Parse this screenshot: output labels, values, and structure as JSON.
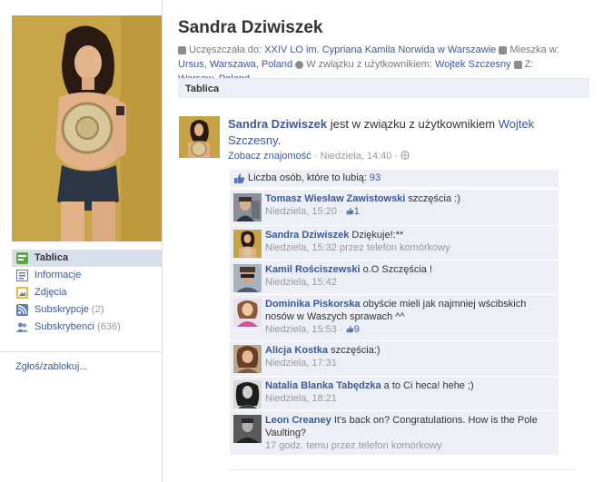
{
  "profile": {
    "name": "Sandra Dziwiszek",
    "info": {
      "school_label": "Uczęszczała do:",
      "school_value": "XXIV LO im. Cypriana Kamila Norwida w Warszawie",
      "lives_label": "Mieszka w:",
      "lives_value": "Ursus, Warszawa, Poland",
      "relationship_label": "W związku z użytkownikiem:",
      "relationship_value": "Wojtek Szczesny",
      "from_label": "Z:",
      "from_value": "Warsaw, Poland"
    }
  },
  "sidebar": {
    "items": [
      {
        "label": "Tablica",
        "count": "",
        "icon": "wall-icon",
        "active": true
      },
      {
        "label": "Informacje",
        "count": "",
        "icon": "info-icon",
        "active": false
      },
      {
        "label": "Zdjęcia",
        "count": "",
        "icon": "photos-icon",
        "active": false
      },
      {
        "label": "Subskrypcje",
        "count": "(2)",
        "icon": "subscriptions-icon",
        "active": false
      },
      {
        "label": "Subskrybenci",
        "count": "(636)",
        "icon": "subscribers-icon",
        "active": false
      }
    ],
    "report_label": "Zgłoś/zablokuj..."
  },
  "wall": {
    "tab_label": "Tablica"
  },
  "story": {
    "author": "Sandra Dziwiszek",
    "text_middle": "jest w związku z użytkownikiem",
    "target": "Wojtek Szczesny",
    "text_end": ".",
    "see_friendship": "Zobacz znajomość",
    "separator": "·",
    "time": "Niedziela, 14:40",
    "privacy_icon": "globe-icon",
    "likes_label": "Liczba osób, które to lubią:",
    "likes_count": "93"
  },
  "comments": [
    {
      "author": "Tomasz Wiesław Zawistowski",
      "text": "szczęścia :)",
      "time": "Niedziela, 15:20",
      "likes": "1",
      "via": ""
    },
    {
      "author": "Sandra Dziwiszek",
      "text": "Dziękuje!:**",
      "time": "Niedziela, 15:32",
      "likes": "",
      "via": "przez telefon komórkowy"
    },
    {
      "author": "Kamil Rościszewski",
      "text": "o.O Szczęścia !",
      "time": "Niedziela, 15:42",
      "likes": "",
      "via": ""
    },
    {
      "author": "Dominika Piskorska",
      "text": "obyście mieli jak najmniej wścibskich nosów w Waszych sprawach ^^",
      "time": "Niedziela, 15:53",
      "likes": "9",
      "via": ""
    },
    {
      "author": "Alicja Kostka",
      "text": "szczęścia:)",
      "time": "Niedziela, 17:31",
      "likes": "",
      "via": ""
    },
    {
      "author": "Natalia Blanka Tabędzka",
      "text": "a to Ci heca! hehe ;)",
      "time": "Niedziela, 18:21",
      "likes": "",
      "via": ""
    },
    {
      "author": "Leon Creaney",
      "text": "It's back on? Congratulations. How is the Pole Vaulting?",
      "time": "17 godz. temu",
      "likes": "",
      "via": "przez telefon komórkowy"
    }
  ],
  "colors": {
    "link": "#3b5998",
    "panel": "#eceff5",
    "active_nav": "#d8dfea"
  }
}
